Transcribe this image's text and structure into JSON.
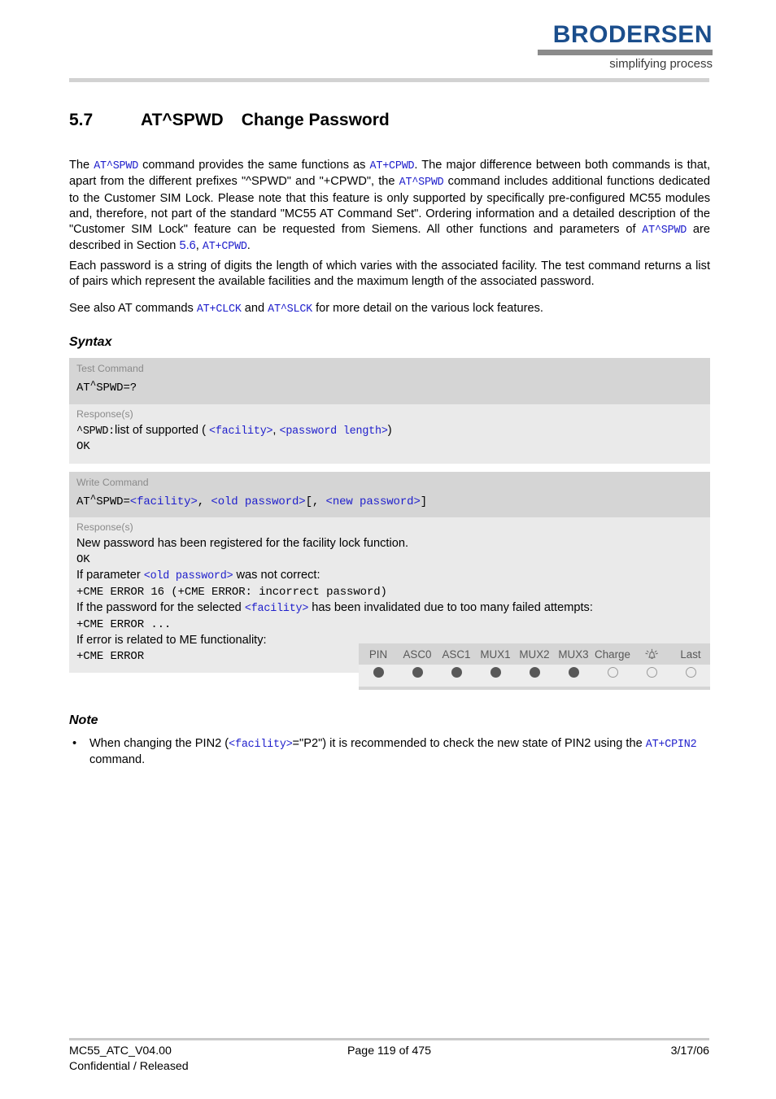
{
  "header": {
    "logo_word": "BRODERSEN",
    "logo_tagline": "simplifying process"
  },
  "title": {
    "number": "5.7",
    "command": "AT^SPWD",
    "text": "Change Password"
  },
  "paragraphs": {
    "p1_a": "The ",
    "p1_cmd1": "AT^SPWD",
    "p1_b": " command provides the same functions as ",
    "p1_cmd2": "AT+CPWD",
    "p1_c": ". The major difference between both commands is that, apart from the different prefixes \"^SPWD\" and \"+CPWD\", the ",
    "p1_cmd3": "AT^SPWD",
    "p1_d": " command includes additional functions dedicated to the Customer SIM Lock. Please note that this feature is only supported by specifically pre-configured MC55 modules and, therefore, not part of the standard \"MC55 AT Command Set\". Ordering information and a detailed description of the \"Customer SIM Lock\" feature can be requested from Siemens. All other functions and parameters of ",
    "p1_cmd4": "AT^SPWD",
    "p1_e": " are described in Section ",
    "p1_link": "5.6",
    "p1_f": ", ",
    "p1_cmd5": "AT+CPWD",
    "p1_g": ".",
    "p2": "Each password is a string of digits the length of which varies with the associated facility. The test command returns a list of pairs which represent the available facilities and the maximum length of the associated password.",
    "p3_a": "See also AT commands ",
    "p3_cmd1": "AT+CLCK",
    "p3_b": " and ",
    "p3_cmd2": "AT^SLCK",
    "p3_c": " for more detail on the various lock features."
  },
  "headings": {
    "syntax": "Syntax",
    "note": "Note"
  },
  "syntax": {
    "test": {
      "command_label": "Test Command",
      "command": "AT^SPWD=?",
      "response_label": "Response(s)",
      "resp_line1_a": "^SPWD:",
      "resp_line1_b": "list of supported ( ",
      "resp_line1_p1": "<facility>",
      "resp_line1_c": ", ",
      "resp_line1_p2": "<password length>",
      "resp_line1_d": ")",
      "resp_line2": "OK"
    },
    "write": {
      "command_label": "Write Command",
      "cmd_a": "AT^SPWD=",
      "cmd_p1": "<facility>",
      "cmd_b": ", ",
      "cmd_p2": "<old password>",
      "cmd_c": "[, ",
      "cmd_p3": "<new password>",
      "cmd_d": "]",
      "response_label": "Response(s)",
      "r1": "New password has been registered for the facility lock function.",
      "r2": "OK",
      "r3_a": "If parameter ",
      "r3_p": "<old password>",
      "r3_b": " was not correct:",
      "r4": "+CME ERROR 16 (+CME ERROR: incorrect password)",
      "r5_a": "If the password for the selected ",
      "r5_p": "<facility>",
      "r5_b": " has been invalidated due to too many failed attempts:",
      "r6": "+CME ERROR ...",
      "r7": "If error is related to ME functionality:",
      "r8": "+CME ERROR"
    }
  },
  "support": {
    "columns": [
      "PIN",
      "ASC0",
      "ASC1",
      "MUX1",
      "MUX2",
      "MUX3",
      "Charge",
      "",
      "Last"
    ],
    "icon_column_index": 7,
    "icon_name": "alarm-bell-icon",
    "states": [
      "on",
      "on",
      "on",
      "on",
      "on",
      "on",
      "off",
      "off",
      "off"
    ]
  },
  "note": {
    "bullet": "•",
    "n1_a": "When changing the PIN2 (",
    "n1_p": "<facility>",
    "n1_b": "=\"P2\") it is recommended to check the new state of PIN2 using the ",
    "n1_cmd": "AT+CPIN2",
    "n1_c": " command."
  },
  "footer": {
    "doc_id": "MC55_ATC_V04.00",
    "classification": "Confidential / Released",
    "page": "Page 119 of 475",
    "date": "3/17/06"
  },
  "colors": {
    "command_blue": "#2020cc",
    "logo_blue": "#1b4e8c",
    "block_header_gray": "#d5d5d5",
    "block_body_gray": "#eaeaea"
  }
}
